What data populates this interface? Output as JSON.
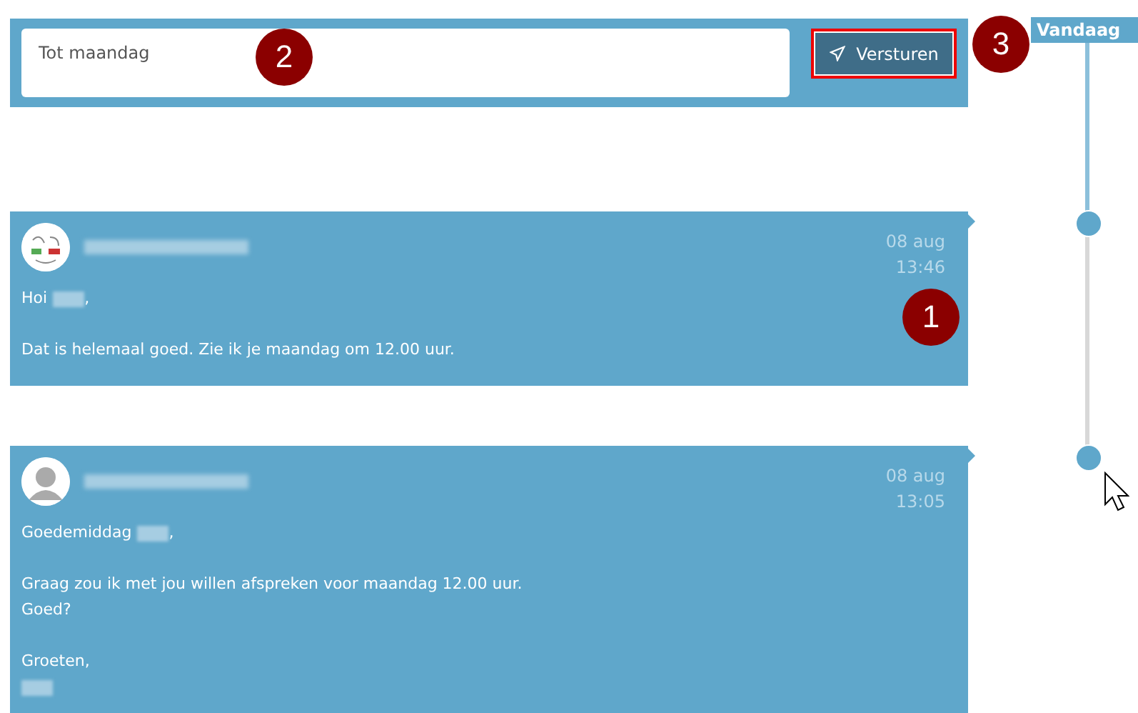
{
  "composer": {
    "value": "Tot maandag",
    "send_button": "Versturen",
    "step_badges": [
      "2",
      "3"
    ]
  },
  "timeline": {
    "label": "Vandaag"
  },
  "messages": [
    {
      "kind": "drawing",
      "date": "08 aug",
      "time": "13:46",
      "badge": "1",
      "paragraphs": [
        [
          {
            "kind": "greeting",
            "text": "Hoi",
            "suffix": ","
          }
        ],
        [
          {
            "kind": "text",
            "text": "Dat is helemaal goed. Zie ik je maandag om 12.00 uur."
          }
        ]
      ]
    },
    {
      "kind": "silhouette",
      "date": "08 aug",
      "time": "13:05",
      "paragraphs": [
        [
          {
            "kind": "greeting",
            "text": "Goedemiddag",
            "suffix": ","
          }
        ],
        [
          {
            "kind": "text",
            "text": "Graag zou ik met jou willen afspreken voor maandag 12.00 uur."
          },
          {
            "kind": "text",
            "text": "Goed?"
          }
        ],
        [
          {
            "kind": "text",
            "text": "Groeten,"
          },
          {
            "kind": "redacted"
          }
        ]
      ]
    }
  ]
}
